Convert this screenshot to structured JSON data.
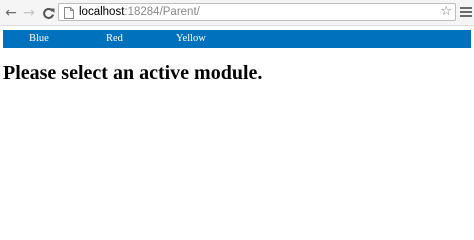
{
  "browser": {
    "back_icon": "back-arrow-icon",
    "forward_icon": "forward-arrow-icon",
    "reload_icon": "reload-icon",
    "url_host": "localhost",
    "url_rest": ":18284/Parent/",
    "star_icon": "bookmark-star-icon",
    "menu_icon": "hamburger-menu-icon"
  },
  "nav": {
    "background": "#0071bc",
    "items": [
      {
        "label": "Blue"
      },
      {
        "label": "Red"
      },
      {
        "label": "Yellow"
      }
    ]
  },
  "main": {
    "heading": "Please select an active module."
  }
}
